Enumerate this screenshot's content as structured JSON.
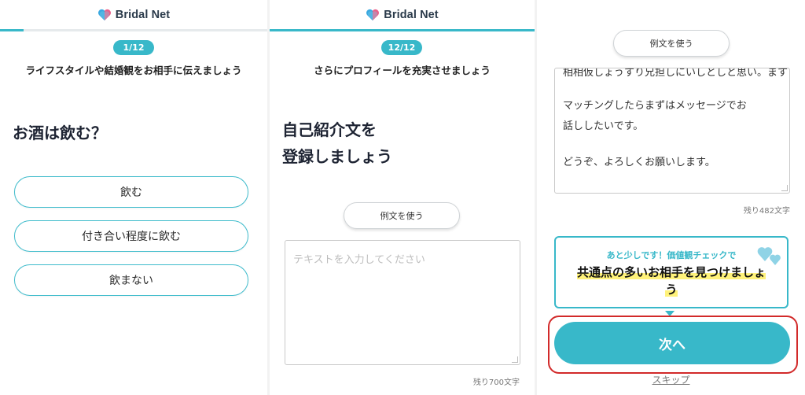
{
  "brand": {
    "name": "Bridal Net",
    "accent": "#38b8c9",
    "heart_colors": [
      "#3aa8e0",
      "#e8608a"
    ]
  },
  "screen1": {
    "step": "1/12",
    "subtitle": "ライフスタイルや結婚観をお相手に伝えましょう",
    "question": "お酒は飲む？",
    "options": [
      "飲む",
      "付き合い程度に飲む",
      "飲まない"
    ],
    "progress": 0.083
  },
  "screen2": {
    "step": "12/12",
    "subtitle": "さらにプロフィールを充実させましょう",
    "title_line1": "自己紹介文を",
    "title_line2": "登録しましょう",
    "example_button": "例文を使う",
    "placeholder": "テキストを入力してください",
    "remaining": "残り700文字",
    "progress": 1.0
  },
  "screen3": {
    "example_button": "例文を使う",
    "text_cut_line": "相相仮しょうすり兄担しにいしとしと思い。ます",
    "text_line1": "マッチングしたらまずはメッセージでお",
    "text_line2": "話ししたいです。",
    "text_line3": "どうぞ、よろしくお願いします。",
    "remaining": "残り482文字",
    "bubble_sub": "あと少しです！価値観チェックで",
    "bubble_main_1": "共通点の多いお相手を見つけましょ",
    "bubble_main_2": "う",
    "next_button": "次へ",
    "skip_link": "スキップ",
    "highlight_color": "#d22a2a"
  }
}
